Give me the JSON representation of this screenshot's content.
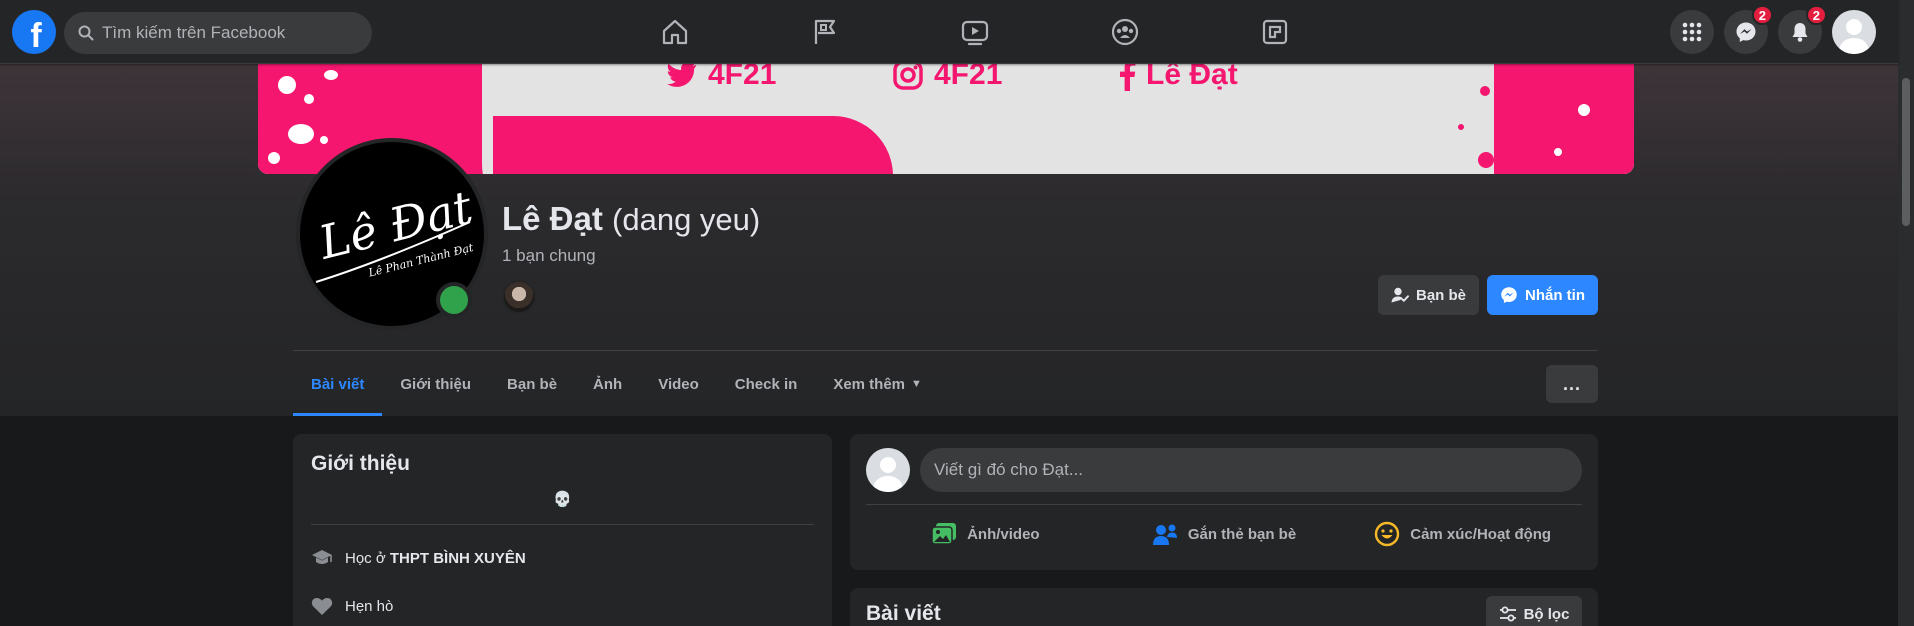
{
  "header": {
    "logo": "f",
    "search_placeholder": "Tìm kiếm trên Facebook",
    "nav_tabs": [
      "home-icon",
      "pages-flag-icon",
      "watch-video-icon",
      "groups-icon",
      "gaming-icon"
    ],
    "messenger_badge": "2",
    "notifications_badge": "2"
  },
  "cover": {
    "items": [
      "4F21",
      "4F21",
      "Lê Đạt"
    ]
  },
  "profile": {
    "avatar_line1": "Lê Đạt",
    "avatar_line2": "Lê Phan Thành Đạt",
    "name": "Lê Đạt",
    "alternate_name": "(dang yeu)",
    "mutual_friends": "1 bạn chung",
    "friends_button": "Bạn bè",
    "message_button": "Nhắn tin",
    "online": true
  },
  "tabs": [
    {
      "label": "Bài viết",
      "active": true
    },
    {
      "label": "Giới thiệu",
      "active": false
    },
    {
      "label": "Bạn bè",
      "active": false
    },
    {
      "label": "Ảnh",
      "active": false
    },
    {
      "label": "Video",
      "active": false
    },
    {
      "label": "Check in",
      "active": false
    },
    {
      "label": "Xem thêm",
      "active": false
    }
  ],
  "more_button": "...",
  "intro": {
    "title": "Giới thiệu",
    "bio": "💀",
    "school_prefix": "Học ở ",
    "school_name": "THPT BÌNH XUYÊN",
    "dating": "Hẹn hò"
  },
  "composer": {
    "placeholder": "Viết gì đó cho Đạt...",
    "actions": [
      "Ảnh/video",
      "Gắn thẻ bạn bè",
      "Cảm xúc/Hoạt động"
    ]
  },
  "posts": {
    "title": "Bài viết",
    "filter_button": "Bộ lọc"
  },
  "colors": {
    "accent": "#2d88ff",
    "brand": "#1877f2",
    "badge": "#e41e3f",
    "online": "#31a24c",
    "cover_pink": "#f5176f"
  }
}
